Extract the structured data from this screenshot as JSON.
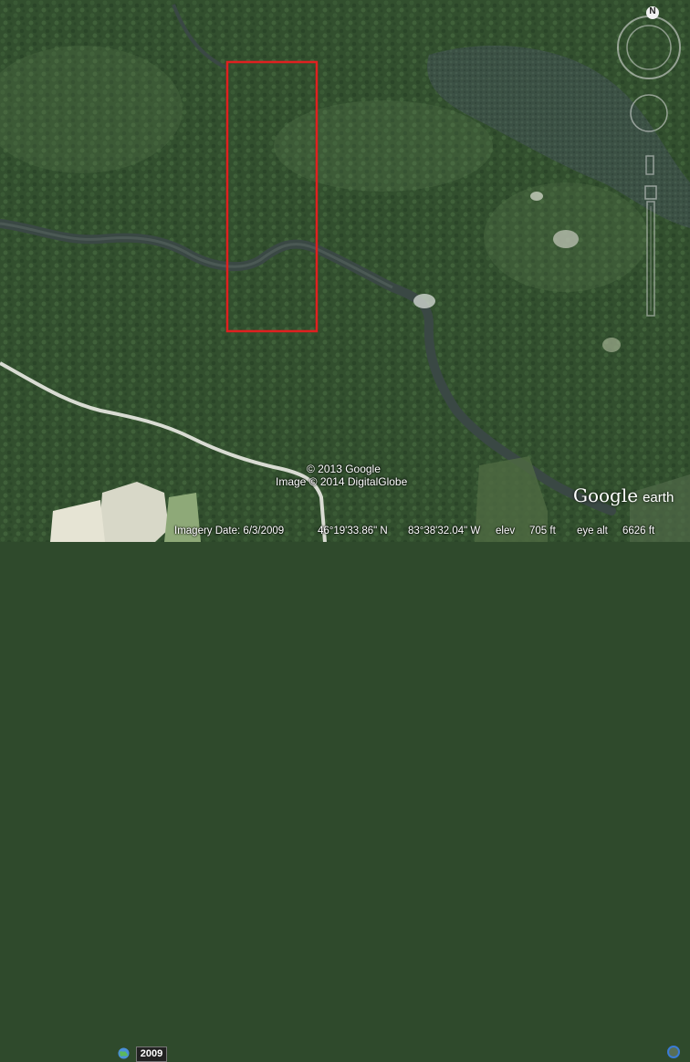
{
  "map": {
    "credits": [
      "© 2013 Google",
      "Image © 2014 DigitalGlobe"
    ],
    "selection_box_color": "#e02020",
    "river_color": "#3a4844"
  },
  "status_bar": {
    "year": "2009",
    "imagery_date": "Imagery Date: 6/3/2009",
    "latitude": "46°19'33.86\" N",
    "longitude": "83°38'32.04\" W",
    "elev_label": "elev",
    "elev_value": "705 ft",
    "eye_alt_label": "eye alt",
    "eye_alt_value": "6626 ft"
  },
  "logo": {
    "main": "Google",
    "sub": "earth"
  },
  "nav": {
    "north_label": "N"
  },
  "icons": {
    "globe": "globe-icon",
    "status": "streaming-status-icon",
    "compass": "compass-icon",
    "look": "look-joystick-icon",
    "move": "move-joystick-icon",
    "zoom": "zoom-slider-icon"
  }
}
